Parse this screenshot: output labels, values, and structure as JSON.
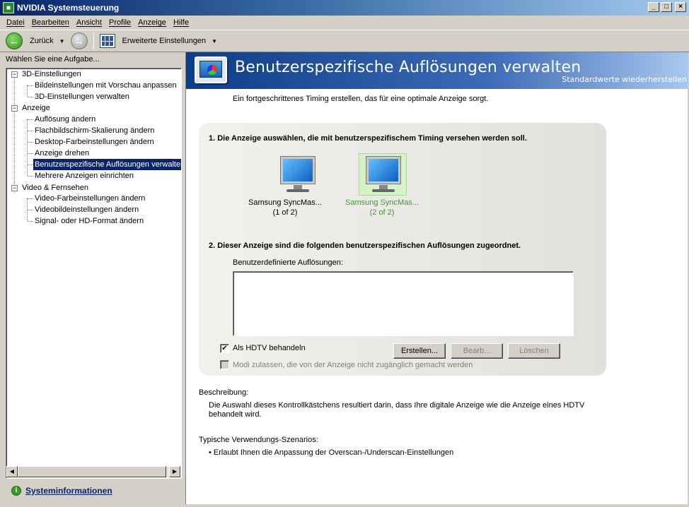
{
  "window": {
    "title": "NVIDIA Systemsteuerung",
    "buttons": [
      "_",
      "□",
      "×"
    ]
  },
  "menu": {
    "items": [
      "Datei",
      "Bearbeiten",
      "Ansicht",
      "Profile",
      "Anzeige",
      "Hilfe"
    ]
  },
  "toolbar": {
    "back_label": "Zurück",
    "advanced_label": "Erweiterte Einstellungen"
  },
  "sidebar": {
    "header": "Wählen Sie eine Aufgabe...",
    "groups": [
      {
        "label": "3D-Einstellungen",
        "items": [
          "Bildeinstellungen mit Vorschau anpassen",
          "3D-Einstellungen verwalten"
        ]
      },
      {
        "label": "Anzeige",
        "items": [
          "Auflösung ändern",
          "Flachbildschirm-Skalierung ändern",
          "Desktop-Farbeinstellungen ändern",
          "Anzeige drehen",
          "Benutzerspezifische Auflösungen verwalten",
          "Mehrere Anzeigen einrichten"
        ]
      },
      {
        "label": "Video & Fernsehen",
        "items": [
          "Video-Farbeinstellungen ändern",
          "Videobildeinstellungen ändern",
          "Signal- oder HD-Format ändern"
        ]
      }
    ],
    "selected_item": "Benutzerspezifische Auflösungen verwalten",
    "system_info_link": "Systeminformationen"
  },
  "main": {
    "title": "Benutzerspezifische Auflösungen verwalten",
    "restore_defaults": "Standardwerte wiederherstellen",
    "intro": "Ein fortgeschrittenes Timing erstellen, das für eine optimale Anzeige sorgt.",
    "step1": "1. Die Anzeige auswählen, die mit benutzerspezifischem Timing versehen werden soll.",
    "displays": [
      {
        "name": "Samsung SyncMas...",
        "index": "(1 of 2)",
        "selected": false
      },
      {
        "name": "Samsung SyncMas...",
        "index": "(2 of 2)",
        "selected": true
      }
    ],
    "step2": "2. Dieser Anzeige sind die folgenden benutzerspezifischen Auflösungen zugeordnet.",
    "list_label": "Benutzerdefinierte Auflösungen:",
    "hdtv_checkbox": {
      "label": "Als HDTV behandeln",
      "checked": true
    },
    "modes_checkbox": {
      "label": "Modi zulassen, die von der Anzeige nicht zugänglich gemacht werden",
      "checked": false,
      "enabled": false
    },
    "buttons": {
      "create": "Erstellen...",
      "edit": "Bearb...",
      "delete": "Löschen"
    },
    "description_heading": "Beschreibung:",
    "description_text": "Die Auswahl dieses Kontrollkästchens resultiert darin, dass Ihre digitale Anzeige wie die Anzeige eines HDTV behandelt wird.",
    "usage_heading": "Typische Verwendungs-Szenarios:",
    "usage_item": "• Erlaubt Ihnen die Anpassung der Overscan-/Underscan-Einstellungen"
  }
}
